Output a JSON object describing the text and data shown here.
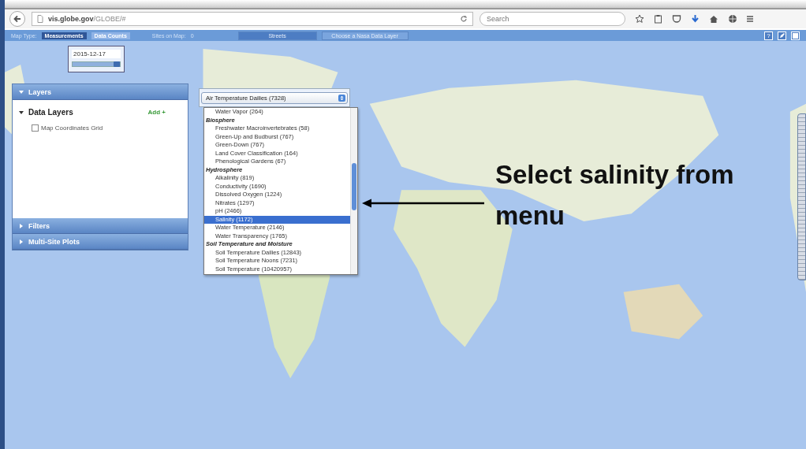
{
  "browser": {
    "url_host": "vis.globe.gov",
    "url_path": "/GLOBE/#",
    "search_placeholder": "Search"
  },
  "toolbar": {
    "map_type_label": "Map Type:",
    "map_types": [
      {
        "label": "Measurements",
        "selected": true
      },
      {
        "label": "Data Counts",
        "selected": false
      }
    ],
    "sites_label": "Sites on Map:",
    "sites_count": "0",
    "base_layer": "Streets",
    "nasa_layer": "Choose a Nasa Data Layer",
    "help": "?"
  },
  "date": {
    "value": "2015-12-17",
    "level": 1
  },
  "layers_panel": {
    "sections": [
      {
        "title": "Layers",
        "expanded": true
      },
      {
        "title": "Filters",
        "expanded": false
      },
      {
        "title": "Multi-Site Plots",
        "expanded": false
      }
    ],
    "data_layers": {
      "title": "Data Layers",
      "expanded": true,
      "add": "Add +",
      "items": [
        {
          "label": "Map Coordinates Grid",
          "checked": false
        }
      ]
    }
  },
  "dropdown": {
    "value": "Air Temperature Dailies (7328)",
    "options": [
      {
        "kind": "option",
        "label": "Water Vapor (264)",
        "selected": false
      },
      {
        "kind": "group",
        "label": "Biosphere"
      },
      {
        "kind": "option",
        "label": "Freshwater Macroinvertebrates (58)",
        "selected": false
      },
      {
        "kind": "option",
        "label": "Green-Up and Budburst (767)",
        "selected": false
      },
      {
        "kind": "option",
        "label": "Green-Down (767)",
        "selected": false
      },
      {
        "kind": "option",
        "label": "Land Cover Classification (164)",
        "selected": false
      },
      {
        "kind": "option",
        "label": "Phenological Gardens (67)",
        "selected": false
      },
      {
        "kind": "group",
        "label": "Hydrosphere"
      },
      {
        "kind": "option",
        "label": "Alkalinity (819)",
        "selected": false
      },
      {
        "kind": "option",
        "label": "Conductivity (1690)",
        "selected": false
      },
      {
        "kind": "option",
        "label": "Dissolved Oxygen (1224)",
        "selected": false
      },
      {
        "kind": "option",
        "label": "Nitrates (1297)",
        "selected": false
      },
      {
        "kind": "option",
        "label": "pH (2466)",
        "selected": false
      },
      {
        "kind": "option",
        "label": "Salinity (1172)",
        "selected": true
      },
      {
        "kind": "option",
        "label": "Water Temperature (2146)",
        "selected": false
      },
      {
        "kind": "option",
        "label": "Water Transparency (1765)",
        "selected": false
      },
      {
        "kind": "group",
        "label": "Soil Temperature and Moisture"
      },
      {
        "kind": "option",
        "label": "Soil Temperature Dailies (12843)",
        "selected": false
      },
      {
        "kind": "option",
        "label": "Soil Temperature Noons (7231)",
        "selected": false
      },
      {
        "kind": "option",
        "label": "Soil Temperature (10420957)",
        "selected": false
      }
    ]
  },
  "annotation": {
    "lines": [
      "Select salinity from",
      "menu"
    ]
  }
}
